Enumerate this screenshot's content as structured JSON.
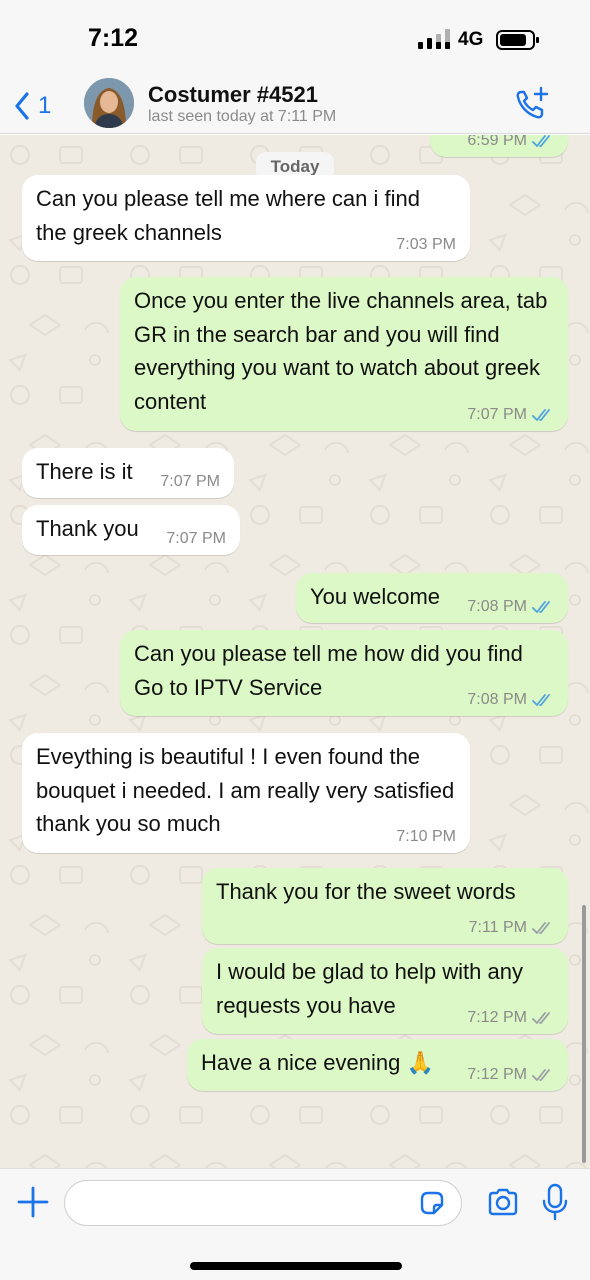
{
  "status_bar": {
    "time": "7:12",
    "network": "4G"
  },
  "header": {
    "back_count": "1",
    "contact_name": "Costumer #4521",
    "contact_status": "last seen today at 7:11 PM"
  },
  "chat": {
    "date_chip": "Today",
    "messages": [
      {
        "direction": "out",
        "text": "",
        "time": "6:59 PM",
        "status": "read"
      },
      {
        "direction": "in",
        "text": "Can you please tell me where can i find the greek channels",
        "time": "7:03 PM"
      },
      {
        "direction": "out",
        "text": "Once you enter the live channels area, tab GR in the search bar and you will find everything you want to watch about greek content",
        "time": "7:07 PM",
        "status": "read"
      },
      {
        "direction": "in",
        "text": "There is it",
        "time": "7:07 PM"
      },
      {
        "direction": "in",
        "text": "Thank you",
        "time": "7:07 PM"
      },
      {
        "direction": "out",
        "text": "You welcome",
        "time": "7:08 PM",
        "status": "read"
      },
      {
        "direction": "out",
        "text": "Can you please tell me how did you find Go to IPTV Service",
        "time": "7:08 PM",
        "status": "read"
      },
      {
        "direction": "in",
        "text": "Eveything is beautiful ! I even found the bouquet i needed. I am really very satisfied thank you so much",
        "time": "7:10 PM"
      },
      {
        "direction": "out",
        "text": "Thank you for the sweet words",
        "time": "7:11 PM",
        "status": "delivered"
      },
      {
        "direction": "out",
        "text": "I would be glad to help with any requests you have",
        "time": "7:12 PM",
        "status": "delivered"
      },
      {
        "direction": "out",
        "text": "Have a nice evening 🙏",
        "time": "7:12 PM",
        "status": "delivered"
      }
    ]
  },
  "input_bar": {
    "placeholder": ""
  },
  "colors": {
    "accent": "#1a73e8",
    "incoming_bubble": "#ffffff",
    "outgoing_bubble": "#dcf8c6",
    "read_tick": "#4fa3e0",
    "delivered_tick": "#9aa0a6",
    "chat_background": "#efeae2"
  },
  "icons": [
    "back-chevron-icon",
    "add-call-icon",
    "plus-icon",
    "sticker-icon",
    "camera-icon",
    "microphone-icon",
    "double-check-icon"
  ]
}
